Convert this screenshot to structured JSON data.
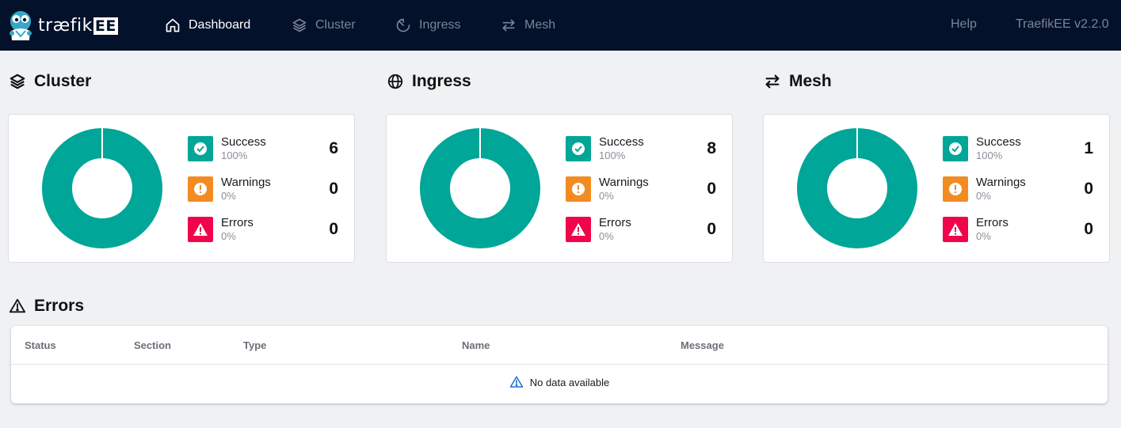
{
  "header": {
    "logo_text": "træfik",
    "logo_ee": "EE",
    "nav": {
      "dashboard": "Dashboard",
      "cluster": "Cluster",
      "ingress": "Ingress",
      "mesh": "Mesh"
    },
    "help": "Help",
    "version": "TraefikEE  v2.2.0"
  },
  "colors": {
    "success": "#00a697",
    "warning": "#f28b22",
    "error": "#f0054b",
    "topbar": "#03112b"
  },
  "cards": [
    {
      "title": "Cluster",
      "icon": "layers-icon",
      "stats": [
        {
          "label": "Success",
          "percent": "100%",
          "count": "6"
        },
        {
          "label": "Warnings",
          "percent": "0%",
          "count": "0"
        },
        {
          "label": "Errors",
          "percent": "0%",
          "count": "0"
        }
      ]
    },
    {
      "title": "Ingress",
      "icon": "globe-icon",
      "stats": [
        {
          "label": "Success",
          "percent": "100%",
          "count": "8"
        },
        {
          "label": "Warnings",
          "percent": "0%",
          "count": "0"
        },
        {
          "label": "Errors",
          "percent": "0%",
          "count": "0"
        }
      ]
    },
    {
      "title": "Mesh",
      "icon": "swap-arrows-icon",
      "stats": [
        {
          "label": "Success",
          "percent": "100%",
          "count": "1"
        },
        {
          "label": "Warnings",
          "percent": "0%",
          "count": "0"
        },
        {
          "label": "Errors",
          "percent": "0%",
          "count": "0"
        }
      ]
    }
  ],
  "errors": {
    "title": "Errors",
    "columns": [
      "Status",
      "Section",
      "Type",
      "Name",
      "Message"
    ],
    "empty_text": "No data available"
  }
}
